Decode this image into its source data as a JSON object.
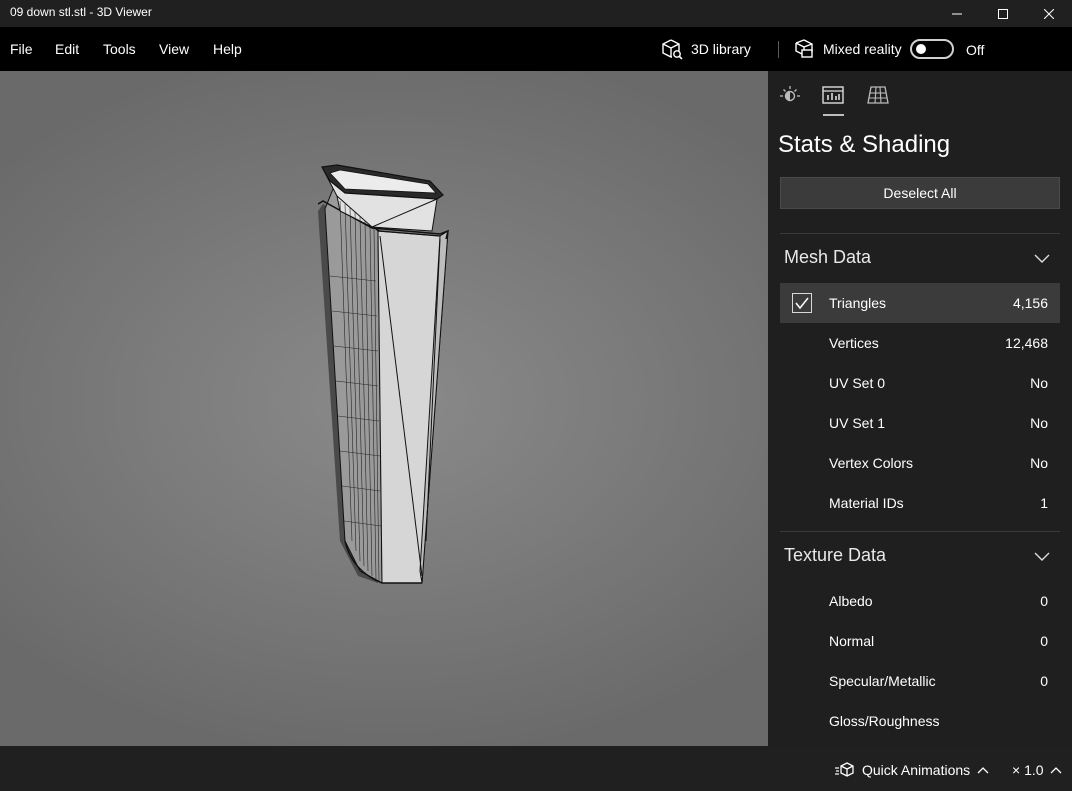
{
  "window": {
    "title": "09 down stl.stl - 3D Viewer"
  },
  "menu": {
    "file": "File",
    "edit": "Edit",
    "tools": "Tools",
    "view": "View",
    "help": "Help"
  },
  "toolbar": {
    "library_label": "3D library",
    "mixed_reality_label": "Mixed reality",
    "mixed_reality_state": "Off",
    "mixed_reality_on": false
  },
  "panel": {
    "tabs": [
      "lighting-icon",
      "stats-icon",
      "grid-icon"
    ],
    "active_tab": "stats-icon",
    "title": "Stats & Shading",
    "deselect_label": "Deselect All",
    "mesh": {
      "heading": "Mesh Data",
      "rows": [
        {
          "label": "Triangles",
          "value": "4,156",
          "checked": true
        },
        {
          "label": "Vertices",
          "value": "12,468"
        },
        {
          "label": "UV Set 0",
          "value": "No"
        },
        {
          "label": "UV Set 1",
          "value": "No"
        },
        {
          "label": "Vertex Colors",
          "value": "No"
        },
        {
          "label": "Material IDs",
          "value": "1"
        }
      ]
    },
    "texture": {
      "heading": "Texture Data",
      "rows": [
        {
          "label": "Albedo",
          "value": "0"
        },
        {
          "label": "Normal",
          "value": "0"
        },
        {
          "label": "Specular/Metallic",
          "value": "0"
        },
        {
          "label": "Gloss/Roughness",
          "value": ""
        }
      ]
    }
  },
  "bottom": {
    "quick_animations": "Quick Animations",
    "speed": "× 1.0"
  },
  "colors": {
    "panel_bg": "#1f1f1f",
    "selected_row": "#3b3b3b",
    "viewport_bg": "#7c7c7c"
  }
}
